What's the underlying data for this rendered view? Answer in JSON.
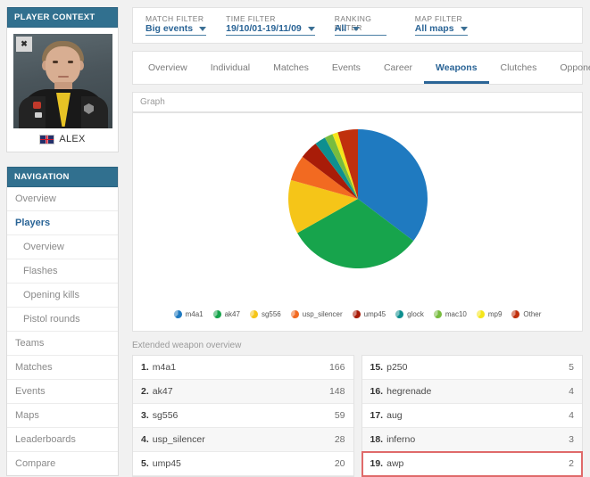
{
  "player_context": {
    "header": "PLAYER CONTEXT",
    "close_icon": "close-icon",
    "player_name": "ALEX",
    "flag": "uk-flag-icon"
  },
  "navigation": {
    "header": "NAVIGATION",
    "items": [
      {
        "label": "Overview",
        "active": false,
        "sub": false
      },
      {
        "label": "Players",
        "active": true,
        "sub": false
      },
      {
        "label": "Overview",
        "active": false,
        "sub": true
      },
      {
        "label": "Flashes",
        "active": false,
        "sub": true
      },
      {
        "label": "Opening kills",
        "active": false,
        "sub": true
      },
      {
        "label": "Pistol rounds",
        "active": false,
        "sub": true
      },
      {
        "label": "Teams",
        "active": false,
        "sub": false
      },
      {
        "label": "Matches",
        "active": false,
        "sub": false
      },
      {
        "label": "Events",
        "active": false,
        "sub": false
      },
      {
        "label": "Maps",
        "active": false,
        "sub": false
      },
      {
        "label": "Leaderboards",
        "active": false,
        "sub": false
      },
      {
        "label": "Compare",
        "active": false,
        "sub": false
      }
    ]
  },
  "filters": [
    {
      "label": "MATCH FILTER",
      "value": "Big events"
    },
    {
      "label": "TIME FILTER",
      "value": "19/10/01-19/11/09"
    },
    {
      "label": "RANKING FILTER",
      "value": "All"
    },
    {
      "label": "MAP FILTER",
      "value": "All maps"
    }
  ],
  "tabs": [
    {
      "label": "Overview",
      "active": false
    },
    {
      "label": "Individual",
      "active": false
    },
    {
      "label": "Matches",
      "active": false
    },
    {
      "label": "Events",
      "active": false
    },
    {
      "label": "Career",
      "active": false
    },
    {
      "label": "Weapons",
      "active": true
    },
    {
      "label": "Clutches",
      "active": false
    },
    {
      "label": "Opponents",
      "active": false
    }
  ],
  "graph": {
    "caption": "Graph"
  },
  "chart_data": {
    "type": "pie",
    "title": "Graph",
    "legend_position": "bottom",
    "grid": false,
    "labels": [
      "m4a1",
      "ak47",
      "sg556",
      "usp_silencer",
      "ump45",
      "glock",
      "mac10",
      "mp9",
      "Other"
    ],
    "values": [
      166,
      148,
      59,
      28,
      20,
      12,
      9,
      6,
      22
    ],
    "colors": [
      "#1f7ac0",
      "#17a44c",
      "#f5c518",
      "#f26a21",
      "#a81c08",
      "#0e8f8f",
      "#78bc3f",
      "#f5e61a",
      "#c0300d"
    ],
    "slice_order_from_top_clockwise": [
      "m4a1",
      "ak47",
      "sg556",
      "usp_silencer",
      "ump45",
      "glock",
      "mac10",
      "mp9",
      "Other"
    ],
    "note": "start angle at top (12 o'clock), drawn clockwise beginning with m4a1"
  },
  "extended_overview": {
    "caption": "Extended weapon overview",
    "left_rows": [
      {
        "rank": "1.",
        "weapon": "m4a1",
        "value": "166",
        "highlight": false
      },
      {
        "rank": "2.",
        "weapon": "ak47",
        "value": "148",
        "highlight": false
      },
      {
        "rank": "3.",
        "weapon": "sg556",
        "value": "59",
        "highlight": false
      },
      {
        "rank": "4.",
        "weapon": "usp_silencer",
        "value": "28",
        "highlight": false
      },
      {
        "rank": "5.",
        "weapon": "ump45",
        "value": "20",
        "highlight": false
      }
    ],
    "right_rows": [
      {
        "rank": "15.",
        "weapon": "p250",
        "value": "5",
        "highlight": false
      },
      {
        "rank": "16.",
        "weapon": "hegrenade",
        "value": "4",
        "highlight": false
      },
      {
        "rank": "17.",
        "weapon": "aug",
        "value": "4",
        "highlight": false
      },
      {
        "rank": "18.",
        "weapon": "inferno",
        "value": "3",
        "highlight": false
      },
      {
        "rank": "19.",
        "weapon": "awp",
        "value": "2",
        "highlight": true
      }
    ]
  },
  "theme": {
    "accent": "#2a6496",
    "header_blue": "#31708f",
    "page_bg": "#f1f1f1",
    "highlight_red": "#e06a6a"
  }
}
